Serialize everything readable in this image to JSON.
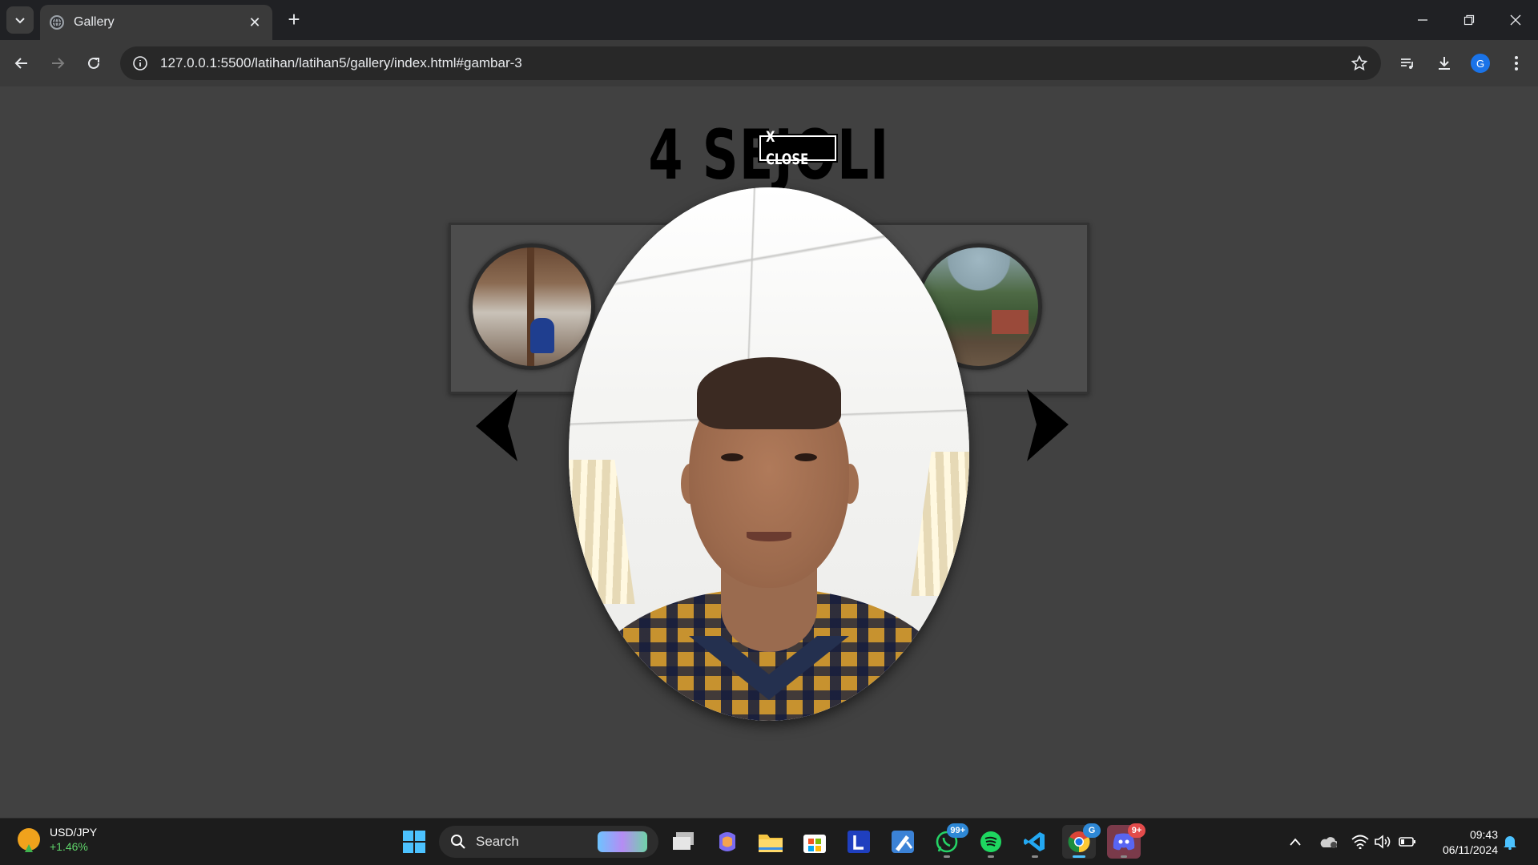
{
  "browser": {
    "tab_title": "Gallery",
    "url": "127.0.0.1:5500/latihan/latihan5/gallery/index.html#gambar-3"
  },
  "page": {
    "title": "4 SEJOLI",
    "close_label": "X CLOSE",
    "prev_icon": "chevron-left-icon",
    "next_icon": "chevron-right-icon"
  },
  "taskbar": {
    "widget_ticker": "USD/JPY",
    "widget_change": "+1.46%",
    "search_placeholder": "Search",
    "whatsapp_badge": "99+",
    "chrome_badge": "G",
    "discord_badge": "9+",
    "time": "09:43",
    "date": "06/11/2024"
  },
  "colors": {
    "page_bg": "#414141",
    "chrome_bg": "#202124",
    "toolbar_bg": "#3a3a3a",
    "accent": "#4cc2ff"
  }
}
